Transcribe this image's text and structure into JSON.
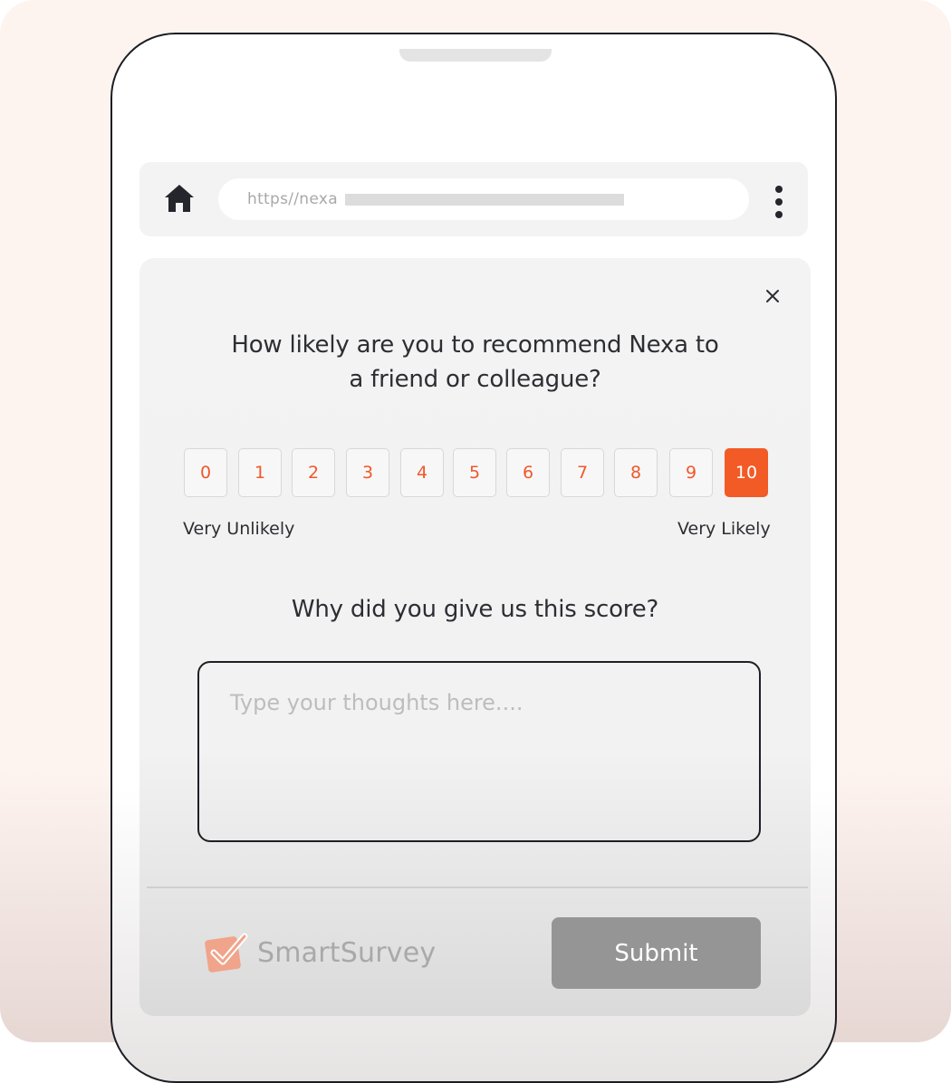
{
  "browser": {
    "url_text": "https//nexa",
    "home_icon": "home-icon",
    "menu_icon": "kebab-menu-icon"
  },
  "survey": {
    "close_icon": "close-icon",
    "question_line1": "How likely are you to recommend Nexa to",
    "question_line2": "a friend or colleague?",
    "scores": [
      "0",
      "1",
      "2",
      "3",
      "4",
      "5",
      "6",
      "7",
      "8",
      "9",
      "10"
    ],
    "selected_score": "10",
    "low_label": "Very Unlikely",
    "high_label": "Very Likely",
    "why_heading": "Why did you give us this score?",
    "feedback_placeholder": "Type your thoughts here....",
    "feedback_value": "",
    "brand_name": "SmartSurvey",
    "submit_label": "Submit"
  },
  "colors": {
    "accent": "#f25a26",
    "score_text": "#f0582b",
    "submit_bg": "#959595",
    "text": "#2d2e33"
  }
}
